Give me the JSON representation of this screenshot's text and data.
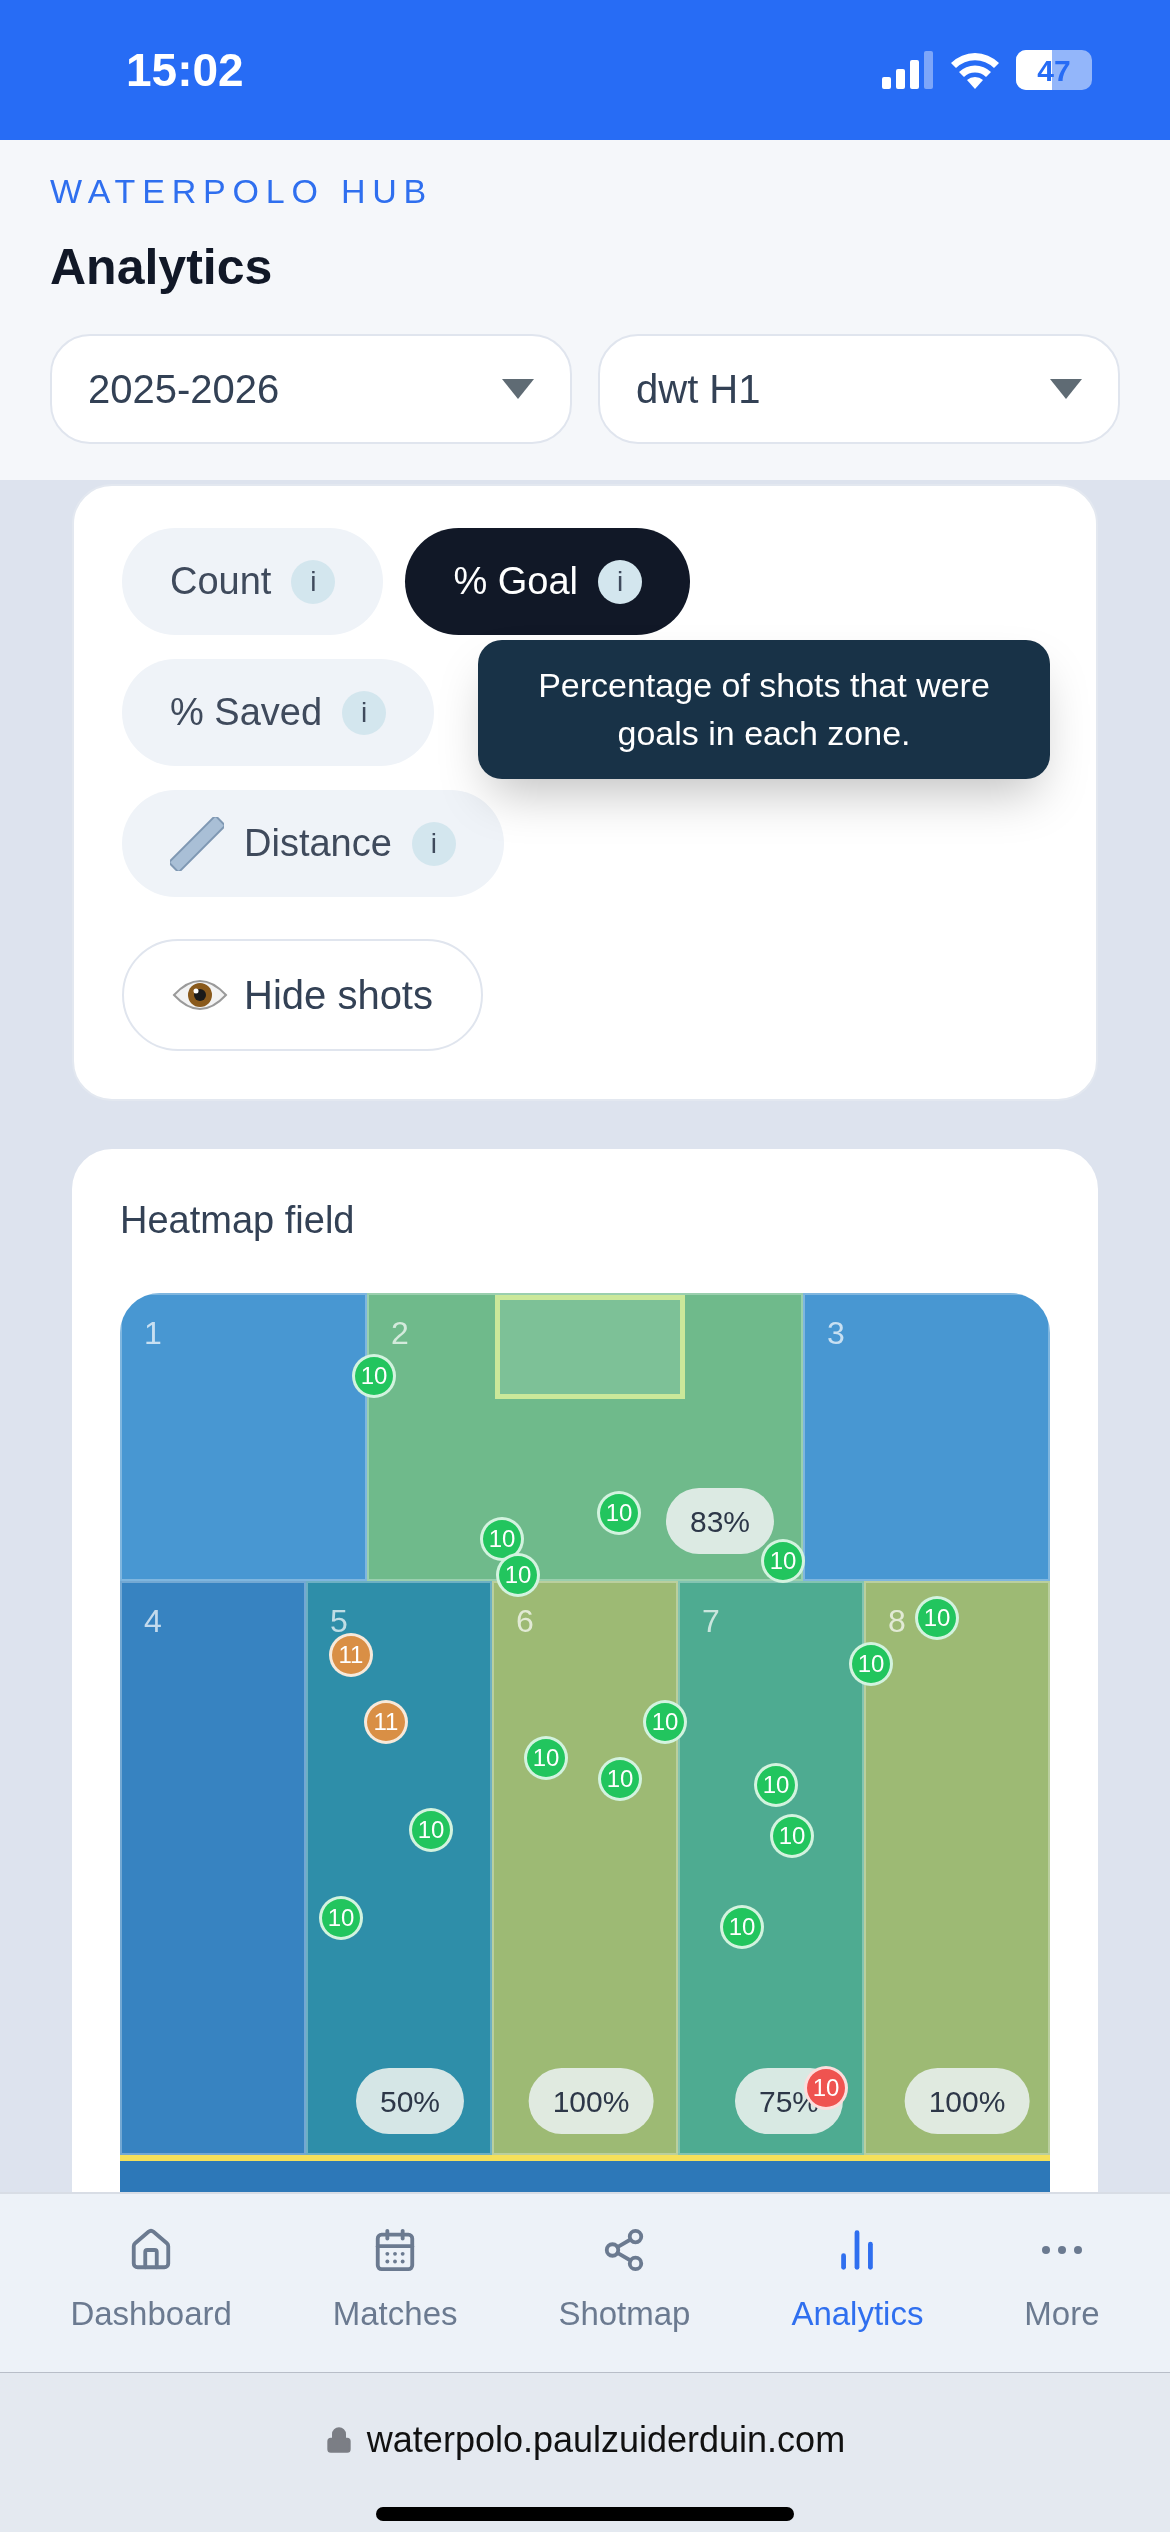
{
  "status_bar": {
    "time": "15:02",
    "battery": "47"
  },
  "header": {
    "brand": "WATERPOLO HUB",
    "title": "Analytics",
    "selects": [
      {
        "value": "2025-2026"
      },
      {
        "value": "dwt H1"
      }
    ]
  },
  "metrics": [
    {
      "kind": "plain",
      "label": "Count",
      "info": "i",
      "selected": false
    },
    {
      "kind": "plain",
      "label": "% Goal",
      "info": "i",
      "selected": true
    },
    {
      "kind": "plain",
      "label": "% Saved",
      "info": "i",
      "selected": false
    },
    {
      "kind": "ruler",
      "label": "Distance",
      "info": "i",
      "selected": false
    }
  ],
  "tooltip": "Percentage of shots that were goals in each zone.",
  "hide_shots": "Hide shots",
  "heatmap": {
    "title": "Heatmap field",
    "zones": [
      {
        "label": "1",
        "color": "#4897d2"
      },
      {
        "label": "2",
        "color": "#6fba8b",
        "value": "83%"
      },
      {
        "label": "3",
        "color": "#4897d2"
      },
      {
        "label": "4",
        "color": "#3783c1"
      },
      {
        "label": "5",
        "color": "#2e8ea9",
        "value": "50%"
      },
      {
        "label": "6",
        "color": "#9dba74",
        "value": "100%"
      },
      {
        "label": "7",
        "color": "#4eab91",
        "value": "75%"
      },
      {
        "label": "8",
        "color": "#9dba74",
        "value": "100%"
      }
    ],
    "shots": [
      {
        "label": "10",
        "color": "#22c55e"
      },
      {
        "label": "10",
        "color": "#22c55e"
      },
      {
        "label": "10",
        "color": "#22c55e"
      },
      {
        "label": "10",
        "color": "#22c55e"
      },
      {
        "label": "10",
        "color": "#22c55e"
      },
      {
        "label": "11",
        "color": "#d98f45"
      },
      {
        "label": "11",
        "color": "#d98f45"
      },
      {
        "label": "10",
        "color": "#22c55e"
      },
      {
        "label": "10",
        "color": "#22c55e"
      },
      {
        "label": "10",
        "color": "#22c55e"
      },
      {
        "label": "10",
        "color": "#22c55e"
      },
      {
        "label": "10",
        "color": "#22c55e"
      },
      {
        "label": "10",
        "color": "#22c55e"
      },
      {
        "label": "10",
        "color": "#22c55e"
      },
      {
        "label": "10",
        "color": "#22c55e"
      },
      {
        "label": "10",
        "color": "#22c55e"
      },
      {
        "label": "10",
        "color": "#22c55e"
      },
      {
        "label": "10",
        "color": "#ef5350"
      }
    ]
  },
  "nav": [
    {
      "kind": "home",
      "label": "Dashboard",
      "selected": false
    },
    {
      "kind": "calendar",
      "label": "Matches",
      "selected": false
    },
    {
      "kind": "share",
      "label": "Shotmap",
      "selected": false
    },
    {
      "kind": "chart",
      "label": "Analytics",
      "selected": true
    },
    {
      "kind": "more",
      "label": "More",
      "selected": false
    }
  ],
  "url": "waterpolo.paulzuiderduin.com"
}
